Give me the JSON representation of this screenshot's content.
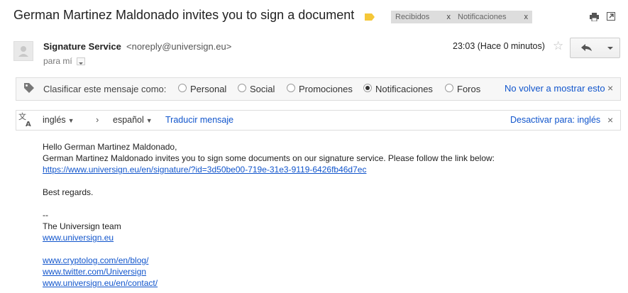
{
  "subject": "German Martinez Maldonado invites you to sign a document",
  "labels": [
    {
      "name": "Recibidos",
      "close": "x"
    },
    {
      "name": "Notificaciones",
      "close": "x"
    }
  ],
  "colors": {
    "label_tag": "#f5c738",
    "link": "#1155cc"
  },
  "sender": {
    "name": "Signature Service",
    "email": "<noreply@universign.eu>",
    "to": "para mí"
  },
  "time": "23:03 (Hace 0 minutos)",
  "classify": {
    "prompt": "Clasificar este mensaje como:",
    "options": [
      "Personal",
      "Social",
      "Promociones",
      "Notificaciones",
      "Foros"
    ],
    "selected": "Notificaciones",
    "dismiss": "No volver a mostrar esto",
    "close": "×"
  },
  "translate": {
    "from": "inglés",
    "to": "español",
    "arrow": "›",
    "action": "Traducir mensaje",
    "deactivate": "Desactivar para: inglés",
    "close": "×"
  },
  "body": {
    "greeting": "Hello German Martinez Maldonado,",
    "line1": "German Martinez Maldonado invites you to sign some documents on our signature service. Please follow the link below:",
    "link": "https://www.universign.eu/en/signature/?id=3d50be00-719e-31e3-9119-6426fb46d7ec",
    "regards": "Best regards.",
    "sig_sep": "--",
    "team": "The Universign team",
    "site": "www.universign.eu",
    "links": [
      "www.cryptolog.com/en/blog/",
      "www.twitter.com/Universign",
      "www.universign.eu/en/contact/"
    ]
  },
  "icons": {
    "label": "label-tag-icon",
    "print": "print-icon",
    "new_window": "new-window-icon",
    "star": "star-icon",
    "reply": "reply-icon",
    "more": "chevron-down-icon",
    "classify": "tag-icon",
    "translate": "translate-icon"
  }
}
